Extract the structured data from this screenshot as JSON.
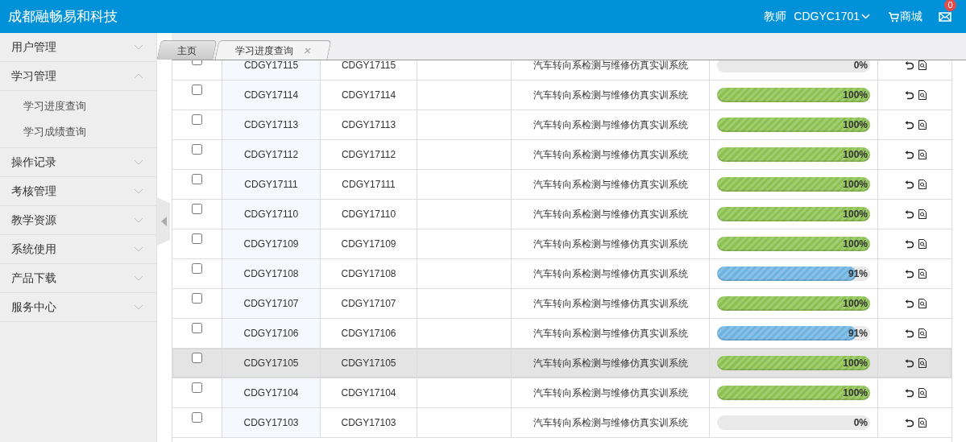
{
  "header": {
    "brand": "成都融畅易和科技",
    "role": "教师",
    "user": "CDGYC1701",
    "shop": "商城",
    "messages": "0"
  },
  "sidebar": {
    "items": [
      {
        "label": "用户管理",
        "expanded": false
      },
      {
        "label": "学习管理",
        "expanded": true,
        "children": [
          {
            "label": "学习进度查询"
          },
          {
            "label": "学习成绩查询"
          }
        ]
      },
      {
        "label": "操作记录",
        "expanded": false
      },
      {
        "label": "考核管理",
        "expanded": false
      },
      {
        "label": "教学资源",
        "expanded": false
      },
      {
        "label": "系统使用",
        "expanded": false
      },
      {
        "label": "产品下载",
        "expanded": false
      },
      {
        "label": "服务中心",
        "expanded": false
      }
    ]
  },
  "tabs": [
    {
      "label": "主页",
      "selected": false,
      "closable": false
    },
    {
      "label": "学习进度查询",
      "selected": true,
      "closable": true
    }
  ],
  "table": {
    "rows": [
      {
        "checked": false,
        "highlighted": false,
        "column_2": "CDGY17115",
        "column_3": "CDGY17115",
        "system": "汽车转向系检测与维修仿真实训系统",
        "level": 0,
        "progress": "0%"
      },
      {
        "checked": false,
        "highlighted": false,
        "column_2": "CDGY17114",
        "column_3": "CDGY17114",
        "system": "汽车转向系检测与维修仿真实训系统",
        "level": 1,
        "progress": "100%",
        "color": "#8cc152"
      },
      {
        "checked": false,
        "highlighted": false,
        "column_2": "CDGY17113",
        "column_3": "CDGY17113",
        "system": "汽车转向系检测与维修仿真实训系统",
        "level": 1,
        "progress": "100%",
        "color": "#8cc152"
      },
      {
        "checked": false,
        "highlighted": false,
        "column_2": "CDGY17112",
        "column_3": "CDGY17112",
        "system": "汽车转向系检测与维修仿真实训系统",
        "level": 1,
        "progress": "100%",
        "color": "#8cc152"
      },
      {
        "checked": false,
        "highlighted": false,
        "column_2": "CDGY17111",
        "column_3": "CDGY17111",
        "system": "汽车转向系检测与维修仿真实训系统",
        "level": 1,
        "progress": "100%",
        "color": "#8cc152"
      },
      {
        "checked": false,
        "highlighted": false,
        "column_2": "CDGY17110",
        "column_3": "CDGY17110",
        "system": "汽车转向系检测与维修仿真实训系统",
        "level": 1,
        "progress": "100%",
        "color": "#8cc152"
      },
      {
        "checked": false,
        "highlighted": false,
        "column_2": "CDGY17109",
        "column_3": "CDGY17109",
        "system": "汽车转向系检测与维修仿真实训系统",
        "level": 1,
        "progress": "100%",
        "color": "#8cc152"
      },
      {
        "checked": false,
        "highlighted": false,
        "column_2": "CDGY17108",
        "column_3": "CDGY17108",
        "system": "汽车转向系检测与维修仿真实训系统",
        "level": 0.91,
        "progress": "91%",
        "color": "#6fb3e0"
      },
      {
        "checked": false,
        "highlighted": false,
        "column_2": "CDGY17107",
        "column_3": "CDGY17107",
        "system": "汽车转向系检测与维修仿真实训系统",
        "level": 1,
        "progress": "100%",
        "color": "#8cc152"
      },
      {
        "checked": false,
        "highlighted": false,
        "column_2": "CDGY17106",
        "column_3": "CDGY17106",
        "system": "汽车转向系检测与维修仿真实训系统",
        "level": 0.91,
        "progress": "91%",
        "color": "#6fb3e0"
      },
      {
        "checked": false,
        "highlighted": true,
        "column_2": "CDGY17105",
        "column_3": "CDGY17105",
        "system": "汽车转向系检测与维修仿真实训系统",
        "level": 1,
        "progress": "100%",
        "color": "#8cc152"
      },
      {
        "checked": false,
        "highlighted": false,
        "column_2": "CDGY17104",
        "column_3": "CDGY17104",
        "system": "汽车转向系检测与维修仿真实训系统",
        "level": 1,
        "progress": "100%",
        "color": "#8cc152"
      },
      {
        "checked": false,
        "highlighted": false,
        "column_2": "CDGY17103",
        "column_3": "CDGY17103",
        "system": "汽车转向系检测与维修仿真实训系统",
        "level": 0,
        "progress": "0%"
      }
    ]
  }
}
